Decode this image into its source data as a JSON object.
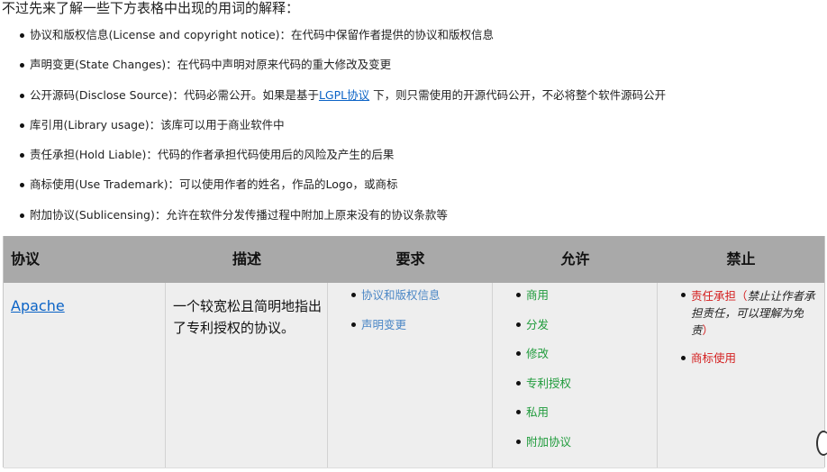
{
  "intro": "不过先来了解一些下方表格中出现的用词的解释：",
  "definitions": [
    {
      "text": "协议和版权信息(License and copyright notice)：在代码中保留作者提供的协议和版权信息"
    },
    {
      "text": "声明变更(State Changes)：在代码中声明对原来代码的重大修改及变更"
    },
    {
      "text_pre": "公开源码(Disclose Source)：代码必需公开。如果是基于",
      "link": "LGPL协议",
      "text_post": " 下，则只需使用的开源代码公开，不必将整个软件源码公开"
    },
    {
      "text": "库引用(Library usage)：该库可以用于商业软件中"
    },
    {
      "text": "责任承担(Hold Liable)：代码的作者承担代码使用后的风险及产生的后果"
    },
    {
      "text": "商标使用(Use Trademark)：可以使用作者的姓名，作品的Logo，或商标"
    },
    {
      "text": "附加协议(Sublicensing)：允许在软件分发传播过程中附加上原来没有的协议条款等"
    }
  ],
  "table": {
    "headers": [
      "协议",
      "描述",
      "要求",
      "允许",
      "禁止"
    ],
    "rows": [
      {
        "name": "Apache",
        "description": "一个较宽松且简明地指出了专利授权的协议。",
        "requires": [
          "协议和版权信息",
          "声明变更"
        ],
        "permits": [
          "商用",
          "分发",
          "修改",
          "专利授权",
          "私用",
          "附加协议"
        ],
        "forbids": [
          {
            "label": "责任承担",
            "note_open": "（",
            "note": "禁止让作者承担责任，可以理解为免责",
            "note_close": "）"
          },
          {
            "label": "商标使用"
          }
        ]
      }
    ]
  },
  "colors": {
    "header_bg": "#a9a9a9",
    "row_bg": "#eeeeee",
    "link": "#0b63c6",
    "requires": "#4a86c5",
    "permits": "#1f9b3b",
    "forbids": "#d42020"
  }
}
